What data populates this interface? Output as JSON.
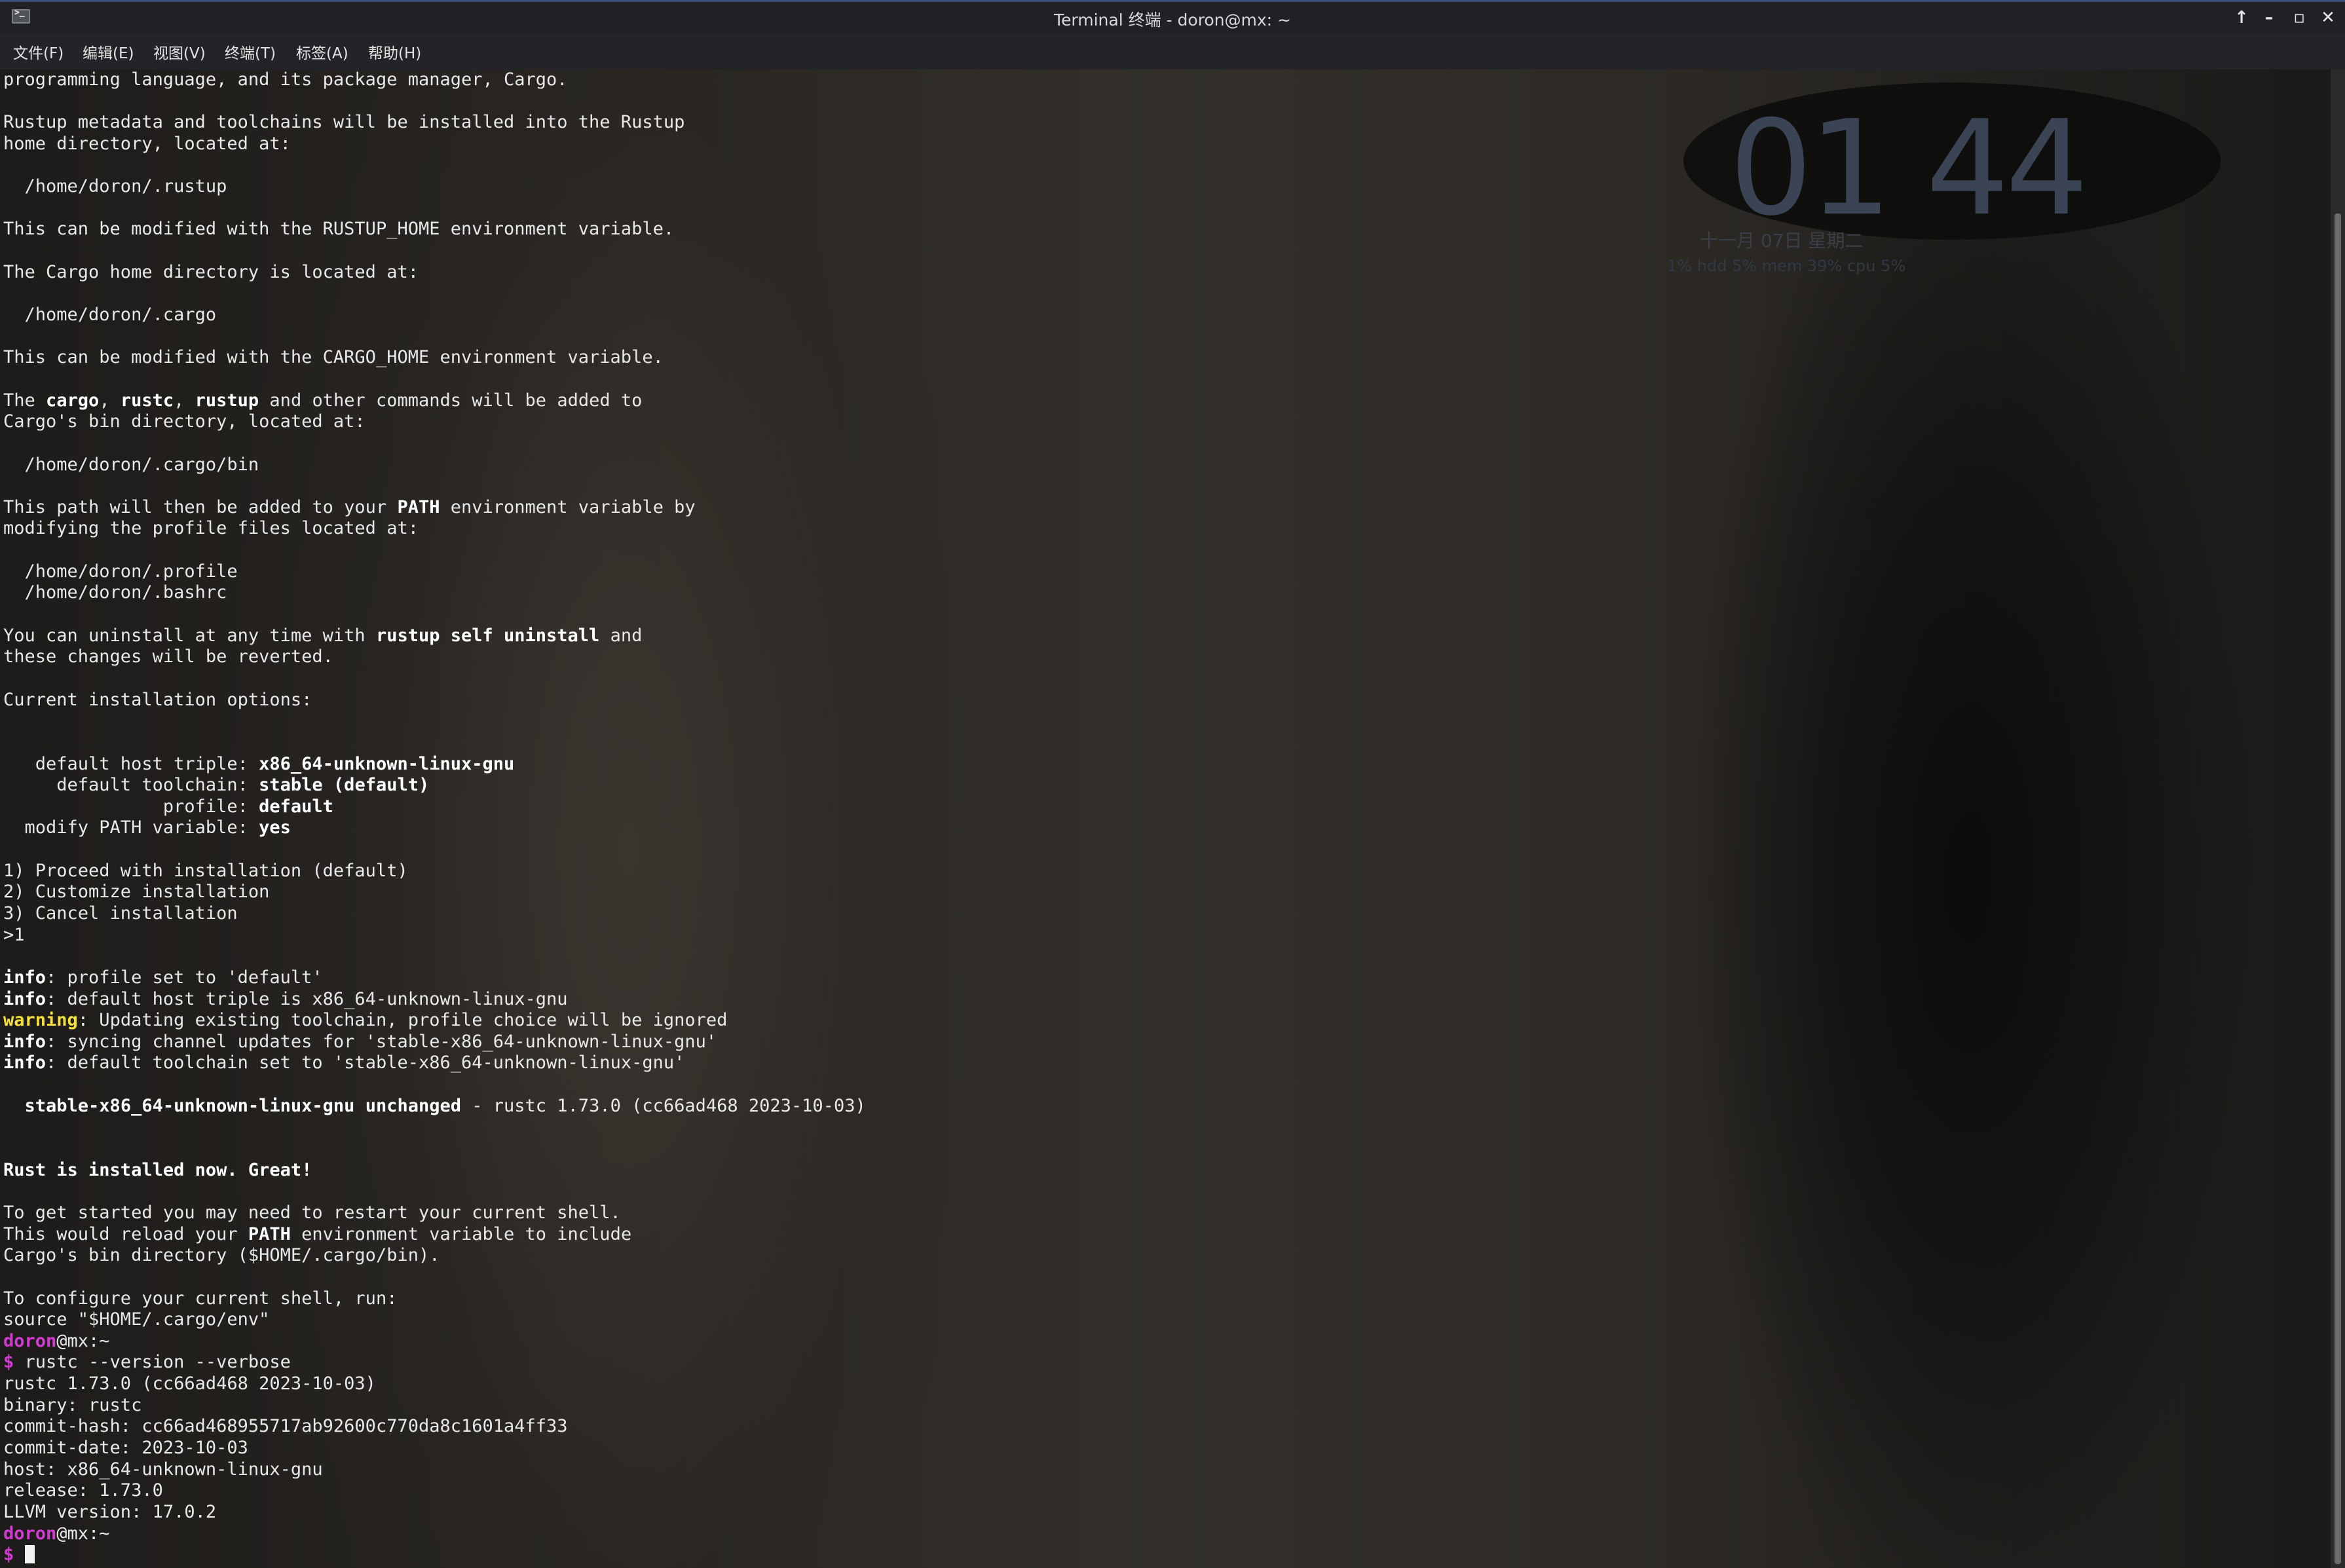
{
  "window": {
    "title": "Terminal 终端 - doron@mx: ~"
  },
  "menu": [
    "文件(F)",
    "编辑(E)",
    "视图(V)",
    "终端(T)",
    "标签(A)",
    "帮助(H)"
  ],
  "desktop_widget": {
    "time": "01 44",
    "date": "十一月 07日 星期二",
    "stats": "1% hdd 5% mem 39% cpu 5%"
  },
  "prompt": {
    "user": "doron",
    "host": "@mx:~",
    "symbol": "$"
  },
  "terminal_lines": [
    [
      {
        "t": "programming language, and its package manager, Cargo."
      }
    ],
    [
      {
        "t": ""
      }
    ],
    [
      {
        "t": "Rustup metadata and toolchains will be installed into the Rustup"
      }
    ],
    [
      {
        "t": "home directory, located at:"
      }
    ],
    [
      {
        "t": ""
      }
    ],
    [
      {
        "t": "  /home/doron/.rustup"
      }
    ],
    [
      {
        "t": ""
      }
    ],
    [
      {
        "t": "This can be modified with the RUSTUP_HOME environment variable."
      }
    ],
    [
      {
        "t": ""
      }
    ],
    [
      {
        "t": "The Cargo home directory is located at:"
      }
    ],
    [
      {
        "t": ""
      }
    ],
    [
      {
        "t": "  /home/doron/.cargo"
      }
    ],
    [
      {
        "t": ""
      }
    ],
    [
      {
        "t": "This can be modified with the CARGO_HOME environment variable."
      }
    ],
    [
      {
        "t": ""
      }
    ],
    [
      {
        "t": "The "
      },
      {
        "t": "cargo",
        "s": "b"
      },
      {
        "t": ", "
      },
      {
        "t": "rustc",
        "s": "b"
      },
      {
        "t": ", "
      },
      {
        "t": "rustup",
        "s": "b"
      },
      {
        "t": " and other commands will be added to"
      }
    ],
    [
      {
        "t": "Cargo's bin directory, located at:"
      }
    ],
    [
      {
        "t": ""
      }
    ],
    [
      {
        "t": "  /home/doron/.cargo/bin"
      }
    ],
    [
      {
        "t": ""
      }
    ],
    [
      {
        "t": "This path will then be added to your "
      },
      {
        "t": "PATH",
        "s": "b"
      },
      {
        "t": " environment variable by"
      }
    ],
    [
      {
        "t": "modifying the profile files located at:"
      }
    ],
    [
      {
        "t": ""
      }
    ],
    [
      {
        "t": "  /home/doron/.profile"
      }
    ],
    [
      {
        "t": "  /home/doron/.bashrc"
      }
    ],
    [
      {
        "t": ""
      }
    ],
    [
      {
        "t": "You can uninstall at any time with "
      },
      {
        "t": "rustup self uninstall",
        "s": "b"
      },
      {
        "t": " and"
      }
    ],
    [
      {
        "t": "these changes will be reverted."
      }
    ],
    [
      {
        "t": ""
      }
    ],
    [
      {
        "t": "Current installation options:"
      }
    ],
    [
      {
        "t": ""
      }
    ],
    [
      {
        "t": ""
      }
    ],
    [
      {
        "t": "   default host triple: "
      },
      {
        "t": "x86_64-unknown-linux-gnu",
        "s": "b"
      }
    ],
    [
      {
        "t": "     default toolchain: "
      },
      {
        "t": "stable (default)",
        "s": "b"
      }
    ],
    [
      {
        "t": "               profile: "
      },
      {
        "t": "default",
        "s": "b"
      }
    ],
    [
      {
        "t": "  modify PATH variable: "
      },
      {
        "t": "yes",
        "s": "b"
      }
    ],
    [
      {
        "t": ""
      }
    ],
    [
      {
        "t": "1) Proceed with installation (default)"
      }
    ],
    [
      {
        "t": "2) Customize installation"
      }
    ],
    [
      {
        "t": "3) Cancel installation"
      }
    ],
    [
      {
        "t": ">1"
      }
    ],
    [
      {
        "t": ""
      }
    ],
    [
      {
        "t": "info",
        "s": "b"
      },
      {
        "t": ": profile set to 'default'"
      }
    ],
    [
      {
        "t": "info",
        "s": "b"
      },
      {
        "t": ": default host triple is x86_64-unknown-linux-gnu"
      }
    ],
    [
      {
        "t": "warning",
        "s": "w"
      },
      {
        "t": ": Updating existing toolchain, profile choice will be ignored"
      }
    ],
    [
      {
        "t": "info",
        "s": "b"
      },
      {
        "t": ": syncing channel updates for 'stable-x86_64-unknown-linux-gnu'"
      }
    ],
    [
      {
        "t": "info",
        "s": "b"
      },
      {
        "t": ": default toolchain set to 'stable-x86_64-unknown-linux-gnu'"
      }
    ],
    [
      {
        "t": ""
      }
    ],
    [
      {
        "t": "  "
      },
      {
        "t": "stable-x86_64-unknown-linux-gnu unchanged",
        "s": "b"
      },
      {
        "t": " - rustc 1.73.0 (cc66ad468 2023-10-03)"
      }
    ],
    [
      {
        "t": ""
      }
    ],
    [
      {
        "t": ""
      }
    ],
    [
      {
        "t": "Rust is installed now. Great!",
        "s": "b"
      }
    ],
    [
      {
        "t": ""
      }
    ],
    [
      {
        "t": "To get started you may need to restart your current shell."
      }
    ],
    [
      {
        "t": "This would reload your "
      },
      {
        "t": "PATH",
        "s": "b"
      },
      {
        "t": " environment variable to include"
      }
    ],
    [
      {
        "t": "Cargo's bin directory ($HOME/.cargo/bin)."
      }
    ],
    [
      {
        "t": ""
      }
    ],
    [
      {
        "t": "To configure your current shell, run:"
      }
    ],
    [
      {
        "t": "source \"$HOME/.cargo/env\""
      }
    ],
    [
      {
        "t": "doron",
        "s": "user"
      },
      {
        "t": "@mx:~"
      }
    ],
    [
      {
        "t": "$",
        "s": "user"
      },
      {
        "t": " rustc --version --verbose"
      }
    ],
    [
      {
        "t": "rustc 1.73.0 (cc66ad468 2023-10-03)"
      }
    ],
    [
      {
        "t": "binary: rustc"
      }
    ],
    [
      {
        "t": "commit-hash: cc66ad468955717ab92600c770da8c1601a4ff33"
      }
    ],
    [
      {
        "t": "commit-date: 2023-10-03"
      }
    ],
    [
      {
        "t": "host: x86_64-unknown-linux-gnu"
      }
    ],
    [
      {
        "t": "release: 1.73.0"
      }
    ],
    [
      {
        "t": "LLVM version: 17.0.2"
      }
    ],
    [
      {
        "t": "doron",
        "s": "user"
      },
      {
        "t": "@mx:~"
      }
    ]
  ],
  "colors": {
    "warning": "#f5e03a",
    "prompt_user": "#d23bd2",
    "title_accent": "#3b4f7a"
  }
}
